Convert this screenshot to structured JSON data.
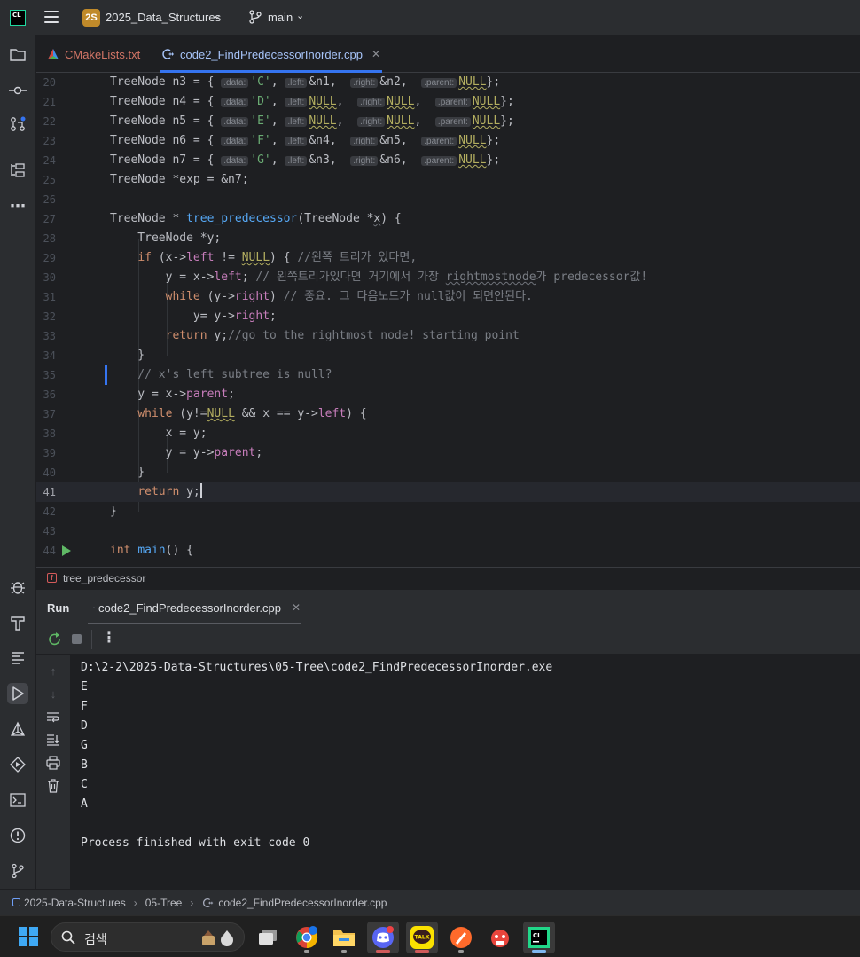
{
  "titlebar": {
    "logo_text": "CL",
    "project_badge": "2S",
    "project_name": "2025_Data_Structures",
    "branch": "main"
  },
  "tabs": [
    {
      "label": "CMakeLists.txt",
      "active": false
    },
    {
      "label": "code2_FindPredecessorInorder.cpp",
      "active": true
    }
  ],
  "editor": {
    "current_line": 41,
    "lines": [
      {
        "n": 20,
        "text": "TreeNode n3 = { .data: 'C', .left: &n1,  .right: &n2,  .parent: NULL};"
      },
      {
        "n": 21,
        "text": "TreeNode n4 = { .data: 'D', .left: NULL,  .right: NULL,  .parent: NULL};"
      },
      {
        "n": 22,
        "text": "TreeNode n5 = { .data: 'E', .left: NULL,  .right: NULL,  .parent: NULL};"
      },
      {
        "n": 23,
        "text": "TreeNode n6 = { .data: 'F', .left: &n4,  .right: &n5,  .parent: NULL};"
      },
      {
        "n": 24,
        "text": "TreeNode n7 = { .data: 'G', .left: &n3,  .right: &n6,  .parent: NULL};"
      },
      {
        "n": 25,
        "text": "TreeNode *exp = &n7;"
      },
      {
        "n": 26,
        "text": ""
      },
      {
        "n": 27,
        "text": "TreeNode * tree_predecessor(TreeNode *x) {"
      },
      {
        "n": 28,
        "text": "    TreeNode *y;"
      },
      {
        "n": 29,
        "text": "    if (x->left != NULL) { //왼쪽 트리가 있다면,"
      },
      {
        "n": 30,
        "text": "        y = x->left; // 왼쪽트리가있다면 거기에서 가장 rightmostnode가 predecessor값!"
      },
      {
        "n": 31,
        "text": "        while (y->right) // 중요. 그 다음노드가 null값이 되면안된다."
      },
      {
        "n": 32,
        "text": "            y= y->right;"
      },
      {
        "n": 33,
        "text": "        return y;//go to the rightmost node! starting point"
      },
      {
        "n": 34,
        "text": "    }"
      },
      {
        "n": 35,
        "text": "    // x's left subtree is null?"
      },
      {
        "n": 36,
        "text": "    y = x->parent;"
      },
      {
        "n": 37,
        "text": "    while (y!=NULL && x == y->left) {"
      },
      {
        "n": 38,
        "text": "        x = y;"
      },
      {
        "n": 39,
        "text": "        y = y->parent;"
      },
      {
        "n": 40,
        "text": "    }"
      },
      {
        "n": 41,
        "text": "    return y;"
      },
      {
        "n": 42,
        "text": "}"
      },
      {
        "n": 43,
        "text": ""
      },
      {
        "n": 44,
        "text": "int main() {"
      }
    ]
  },
  "editor_breadcrumb": "tree_predecessor",
  "run_panel": {
    "title": "Run",
    "tab_label": "code2_FindPredecessorInorder.cpp",
    "output": [
      "D:\\2-2\\2025-Data-Structures\\05-Tree\\code2_FindPredecessorInorder.exe",
      "E",
      "F",
      "D",
      "G",
      "B",
      "C",
      "A",
      "",
      "Process finished with exit code 0"
    ]
  },
  "status_breadcrumb": [
    "2025-Data-Structures",
    "05-Tree",
    "code2_FindPredecessorInorder.cpp"
  ],
  "taskbar": {
    "search_placeholder": "검색",
    "apps": [
      "task-view",
      "chrome",
      "file-explorer",
      "discord",
      "kakaotalk",
      "paint-app",
      "pdf-app",
      "clion"
    ]
  },
  "colors": {
    "accent": "#3574f0",
    "keyword": "#cf8e6d",
    "function": "#56a8f5",
    "field": "#c77dbb",
    "string": "#6aab73",
    "comment": "#7a7e85",
    "macro": "#b3ae60"
  }
}
